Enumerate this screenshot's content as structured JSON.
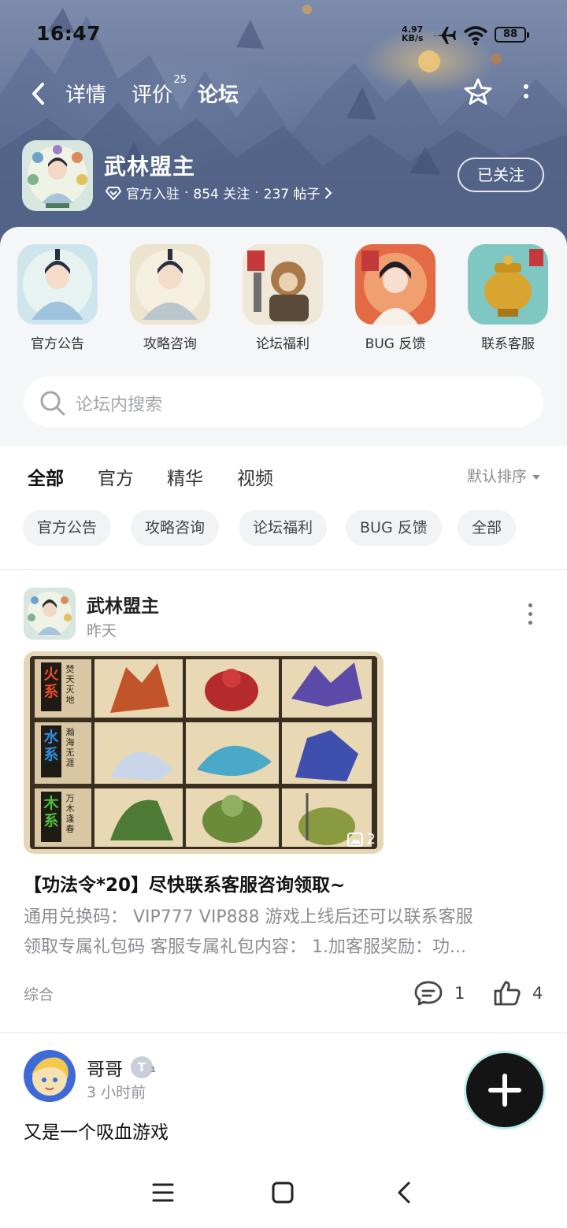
{
  "status_bar": {
    "time": "16:47",
    "net_speed_value": "4.97",
    "net_speed_unit": "KB/s",
    "battery": "88"
  },
  "nav": {
    "tabs": [
      {
        "label": "详情"
      },
      {
        "label": "评价",
        "badge": "25"
      },
      {
        "label": "论坛"
      }
    ],
    "active_tab": "论坛"
  },
  "game": {
    "name": "武林盟主",
    "verified_label": "官方入驻",
    "followers": "854 关注",
    "posts": "237 帖子",
    "separator": "·",
    "follow_button": "已关注"
  },
  "categories": [
    {
      "label": "官方公告"
    },
    {
      "label": "攻略咨询"
    },
    {
      "label": "论坛福利"
    },
    {
      "label": "BUG 反馈"
    },
    {
      "label": "联系客服"
    }
  ],
  "search": {
    "placeholder": "论坛内搜索"
  },
  "feed_tabs": [
    "全部",
    "官方",
    "精华",
    "视频"
  ],
  "sort_label": "默认排序",
  "chips": [
    "官方公告",
    "攻略咨询",
    "论坛福利",
    "BUG 反馈",
    "全部"
  ],
  "posts": [
    {
      "author": "武林盟主",
      "time": "昨天",
      "image_count": "2",
      "image_labels": [
        {
          "element": "火系",
          "motto": "焚天灭地"
        },
        {
          "element": "水系",
          "motto": "瀚海无涯"
        },
        {
          "element": "木系",
          "motto": "万木逢春"
        }
      ],
      "title": "【功法令*20】尽快联系客服咨询领取~",
      "body_line1": "通用兑换码： VIP777 VIP888 游戏上线后还可以联系客服",
      "body_line2": "领取专属礼包码 客服专属礼包内容： 1.加客服奖励：功...",
      "tag": "综合",
      "comments": "1",
      "likes": "4"
    },
    {
      "author": "哥哥",
      "level": "T",
      "level_sub": "1",
      "time": "3 小时前",
      "content": "又是一个吸血游戏"
    }
  ],
  "colors": {
    "accent": "#2bd0bc",
    "sheet_bg": "#f5f6f8",
    "muted_text": "#8a8d92"
  },
  "icons": [
    "back-icon",
    "star-icon",
    "more-icon",
    "search-icon",
    "comment-icon",
    "like-icon",
    "image-icon",
    "plus-icon",
    "menu-icon",
    "home-icon",
    "back-nav-icon"
  ]
}
